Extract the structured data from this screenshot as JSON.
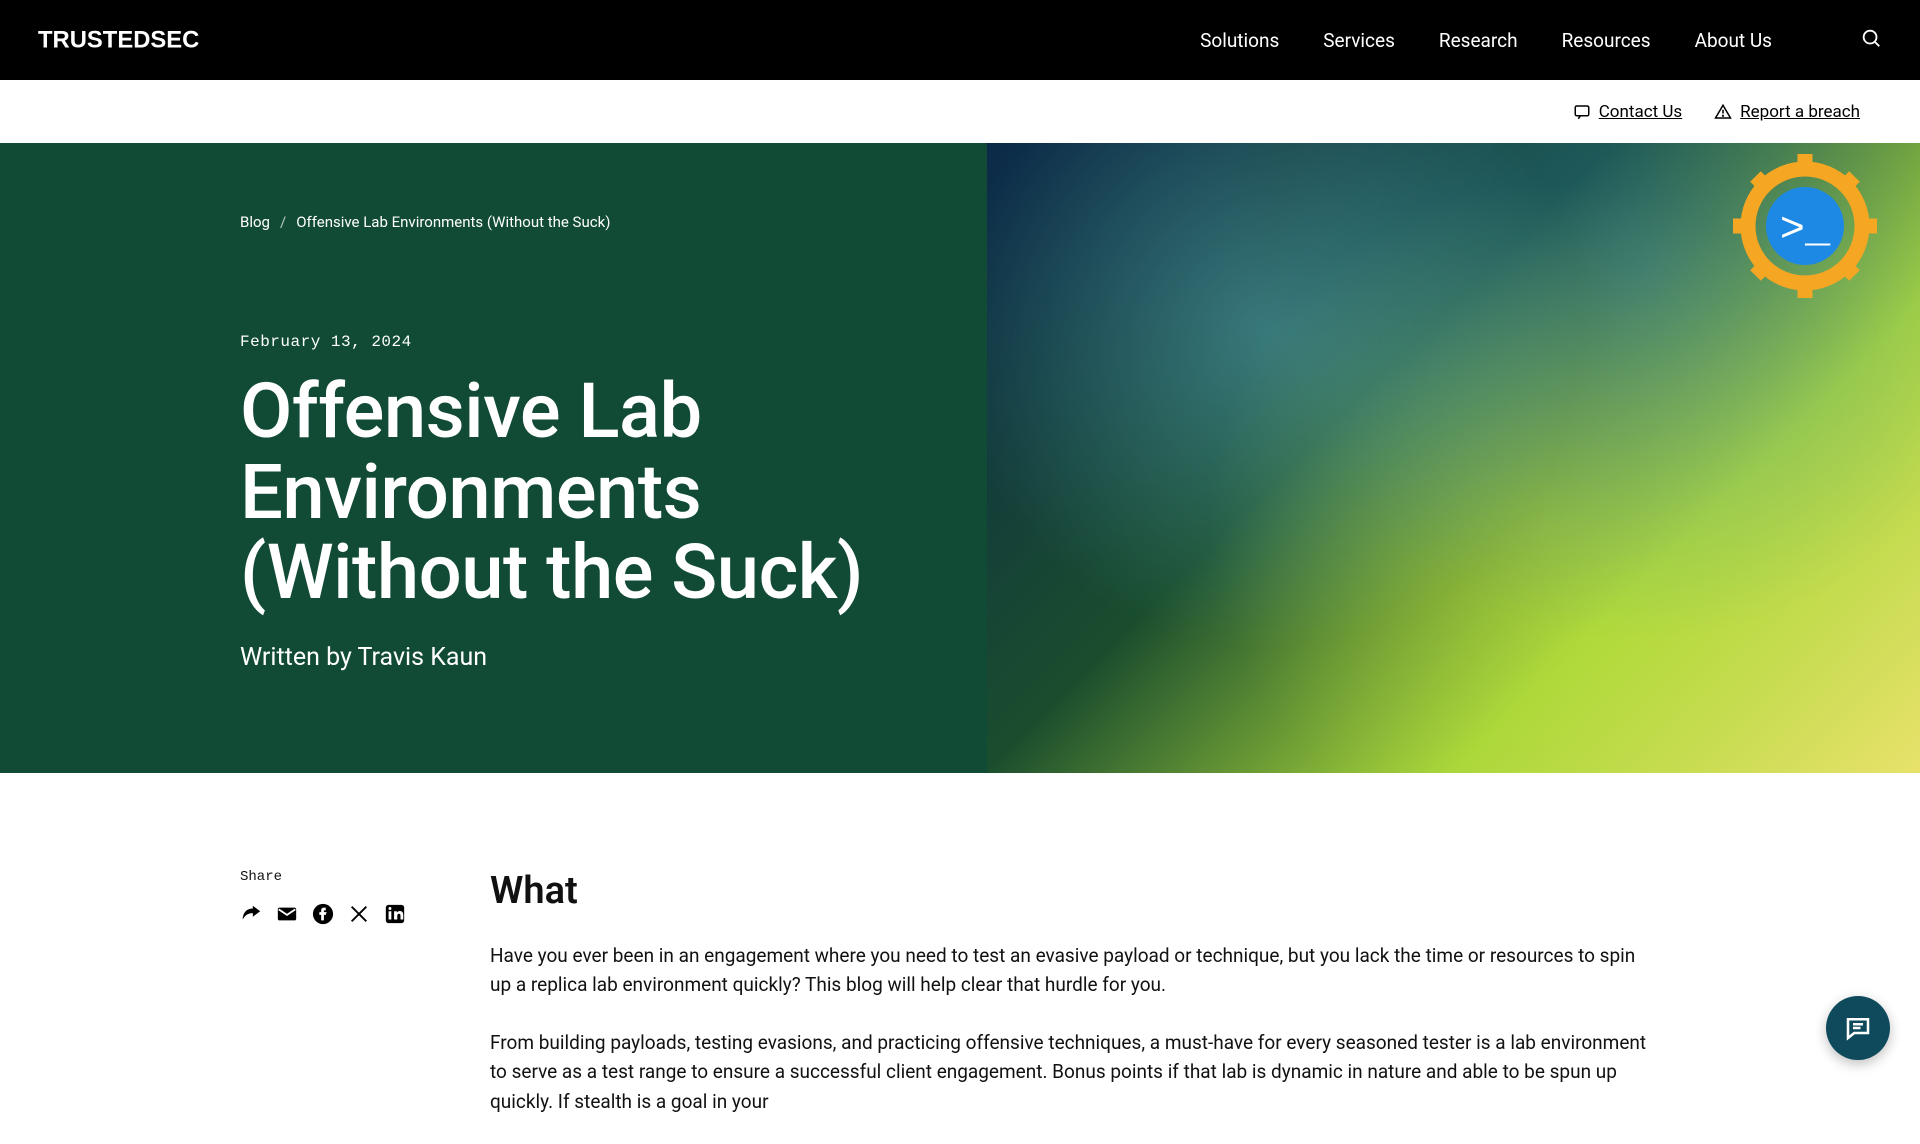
{
  "brand": "TRUSTEDSEC",
  "nav": {
    "items": [
      "Solutions",
      "Services",
      "Research",
      "Resources",
      "About Us"
    ]
  },
  "subnav": {
    "contact": "Contact Us",
    "report": "Report a breach"
  },
  "breadcrumb": {
    "root": "Blog",
    "current": "Offensive Lab Environments (Without the Suck)"
  },
  "post": {
    "date": "February 13, 2024",
    "title": "Offensive Lab Environments (Without the Suck)",
    "byline": "Written by Travis Kaun"
  },
  "share": {
    "label": "Share"
  },
  "article": {
    "heading": "What",
    "p1": "Have you ever been in an engagement where you need to test an evasive payload or technique, but you lack the time or resources to spin up a replica lab environment quickly? This blog will help clear that hurdle for you.",
    "p2": "From building payloads, testing evasions, and practicing offensive techniques, a must-have for every seasoned tester is a lab environment to serve as a test range to ensure a successful client engagement. Bonus points if that lab is dynamic in nature and able to be spun up quickly. If stealth is a goal in your"
  },
  "colors": {
    "heroGreen": "#114b35",
    "chat": "#0e4a5c"
  }
}
